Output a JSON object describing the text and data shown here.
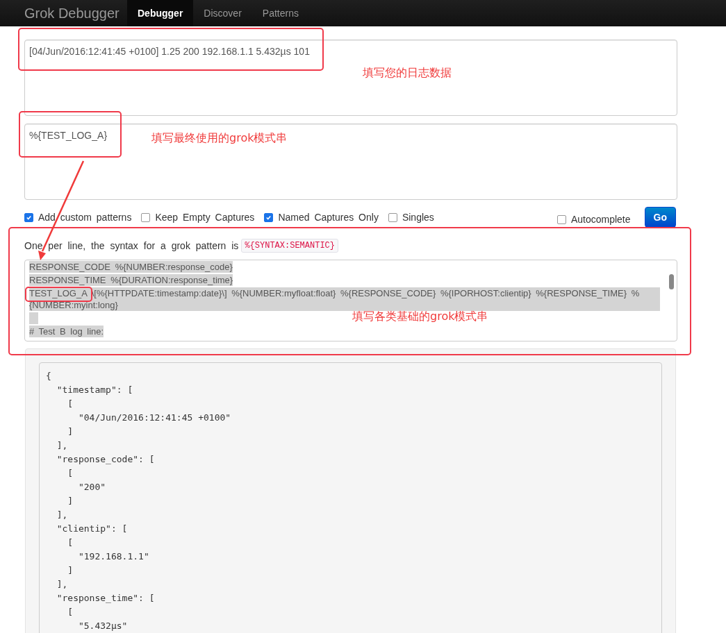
{
  "navbar": {
    "brand": "Grok Debugger",
    "tabs": [
      {
        "label": "Debugger",
        "selected": true
      },
      {
        "label": "Discover",
        "selected": false
      },
      {
        "label": "Patterns",
        "selected": false
      }
    ]
  },
  "log_input": {
    "value": "[04/Jun/2016:12:41:45 +0100] 1.25 200 192.168.1.1 5.432µs 101"
  },
  "pattern_input": {
    "value": "%{TEST_LOG_A}"
  },
  "options": [
    {
      "label": "Add custom patterns",
      "checked": true
    },
    {
      "label": "Keep Empty Captures",
      "checked": false
    },
    {
      "label": "Named Captures Only",
      "checked": true
    },
    {
      "label": "Singles",
      "checked": false
    }
  ],
  "autocomplete": {
    "label": "Autocomplete",
    "checked": false
  },
  "go_button": "Go",
  "custom_patterns": {
    "help": "One per line, the syntax for a grok pattern is",
    "syntax": "%{SYNTAX:SEMANTIC}",
    "lines": [
      {
        "kind": "text",
        "text": "RESPONSE_CODE %{NUMBER:response_code}"
      },
      {
        "kind": "text",
        "text": "RESPONSE_TIME %{DURATION:response_time}"
      },
      {
        "kind": "text",
        "text": "TEST_LOG_A \\[%{HTTPDATE:timestamp:date}\\] %{NUMBER:myfloat:float} %{RESPONSE_CODE} %{IPORHOST:clientip} %{RESPONSE_TIME} %{NUMBER:myint:long}"
      },
      {
        "kind": "blank"
      },
      {
        "kind": "text",
        "text": "# Test B log line:"
      }
    ]
  },
  "output_lines": [
    "{",
    "  \"timestamp\": [",
    "    [",
    "      \"04/Jun/2016:12:41:45 +0100\"",
    "    ]",
    "  ],",
    "  \"response_code\": [",
    "    [",
    "      \"200\"",
    "    ]",
    "  ],",
    "  \"clientip\": [",
    "    [",
    "      \"192.168.1.1\"",
    "    ]",
    "  ],",
    "  \"response_time\": [",
    "    [",
    "      \"5.432µs\""
  ],
  "annotations": [
    "填写您的日志数据",
    "填写最终使用的grok模式串",
    "填写各类基础的grok模式串"
  ]
}
